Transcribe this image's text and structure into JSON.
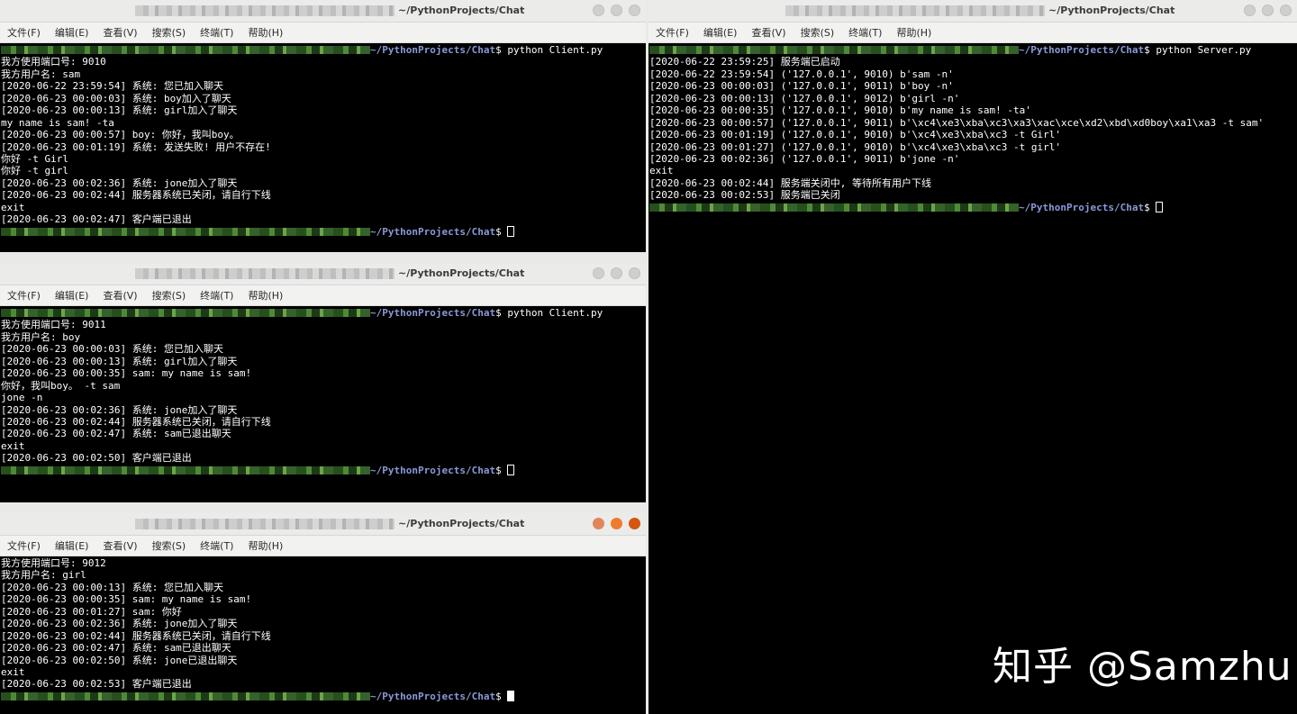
{
  "menu": [
    "文件(F)",
    "编辑(E)",
    "查看(V)",
    "搜索(S)",
    "终端(T)",
    "帮助(H)"
  ],
  "title_path": "~/PythonProjects/Chat",
  "prompt_path": "~/PythonProjects/Chat",
  "watermark": "知乎 @Samzhu",
  "windows": {
    "client_sam": {
      "command": "python Client.py",
      "lines": [
        "我方使用端口号: 9010",
        "我方用户名: sam",
        "[2020-06-22 23:59:54] 系统: 您已加入聊天",
        "[2020-06-23 00:00:03] 系统: boy加入了聊天",
        "[2020-06-23 00:00:13] 系统: girl加入了聊天",
        "my name is sam! -ta",
        "[2020-06-23 00:00:57] boy: 你好，我叫boy。",
        "[2020-06-23 00:01:19] 系统: 发送失败! 用户不存在!",
        "你好 -t Girl",
        "你好 -t girl",
        "[2020-06-23 00:02:36] 系统: jone加入了聊天",
        "[2020-06-23 00:02:44] 服务器系统已关闭，请自行下线",
        "exit",
        "[2020-06-23 00:02:47] 客户端已退出"
      ]
    },
    "client_boy": {
      "command": "python Client.py",
      "lines": [
        "我方使用端口号: 9011",
        "我方用户名: boy",
        "[2020-06-23 00:00:03] 系统: 您已加入聊天",
        "[2020-06-23 00:00:13] 系统: girl加入了聊天",
        "[2020-06-23 00:00:35] sam: my name is sam!",
        "你好，我叫boy。 -t sam",
        "jone -n",
        "[2020-06-23 00:02:36] 系统: jone加入了聊天",
        "[2020-06-23 00:02:44] 服务器系统已关闭，请自行下线",
        "[2020-06-23 00:02:47] 系统: sam已退出聊天",
        "exit",
        "[2020-06-23 00:02:50] 客户端已退出"
      ]
    },
    "client_girl": {
      "lines": [
        "我方使用端口号: 9012",
        "我方用户名: girl",
        "[2020-06-23 00:00:13] 系统: 您已加入聊天",
        "[2020-06-23 00:00:35] sam: my name is sam!",
        "[2020-06-23 00:01:27] sam: 你好",
        "[2020-06-23 00:02:36] 系统: jone加入了聊天",
        "[2020-06-23 00:02:44] 服务器系统已关闭，请自行下线",
        "[2020-06-23 00:02:47] 系统: sam已退出聊天",
        "[2020-06-23 00:02:50] 系统: jone已退出聊天",
        "exit",
        "[2020-06-23 00:02:53] 客户端已退出"
      ]
    },
    "server": {
      "command": "python Server.py",
      "lines": [
        "[2020-06-22 23:59:25] 服务端已启动",
        "[2020-06-22 23:59:54] ('127.0.0.1', 9010) b'sam -n'",
        "[2020-06-23 00:00:03] ('127.0.0.1', 9011) b'boy -n'",
        "[2020-06-23 00:00:13] ('127.0.0.1', 9012) b'girl -n'",
        "[2020-06-23 00:00:35] ('127.0.0.1', 9010) b'my name is sam! -ta'",
        "[2020-06-23 00:00:57] ('127.0.0.1', 9011) b'\\xc4\\xe3\\xba\\xc3\\xa3\\xac\\xce\\xd2\\xbd\\xd0boy\\xa1\\xa3 -t sam'",
        "[2020-06-23 00:01:19] ('127.0.0.1', 9010) b'\\xc4\\xe3\\xba\\xc3 -t Girl'",
        "[2020-06-23 00:01:27] ('127.0.0.1', 9010) b'\\xc4\\xe3\\xba\\xc3 -t girl'",
        "[2020-06-23 00:02:36] ('127.0.0.1', 9011) b'jone -n'",
        "exit",
        "[2020-06-23 00:02:44] 服务端关闭中, 等待所有用户下线",
        "[2020-06-23 00:02:53] 服务端已关闭"
      ]
    }
  }
}
